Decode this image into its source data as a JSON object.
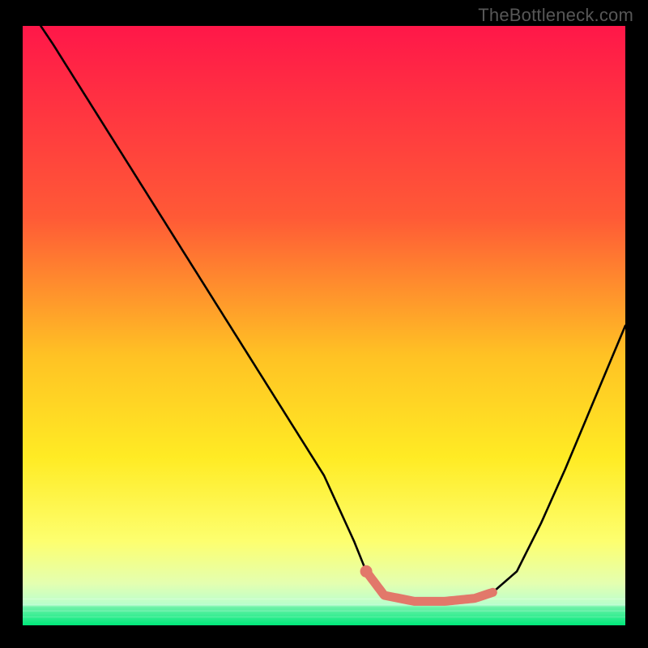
{
  "watermark": "TheBottleneck.com",
  "colors": {
    "gradient_top": "#ff1749",
    "gradient_mid1": "#ff7f2a",
    "gradient_mid2": "#ffeb24",
    "gradient_mid3": "#fdff6f",
    "gradient_mid4": "#e4ffb0",
    "gradient_bottom": "#00e87a",
    "curve": "#000000",
    "highlight": "#e2786a",
    "highlight_dot": "#e2786a"
  },
  "chart_data": {
    "type": "line",
    "title": "",
    "xlabel": "",
    "ylabel": "",
    "xlim": [
      0,
      100
    ],
    "ylim": [
      0,
      100
    ],
    "series": [
      {
        "name": "bottleneck_curve",
        "x": [
          3,
          5,
          10,
          15,
          20,
          25,
          30,
          35,
          40,
          45,
          50,
          55,
          57,
          60,
          65,
          70,
          75,
          78,
          82,
          86,
          90,
          95,
          100
        ],
        "y": [
          100,
          97,
          89,
          81,
          73,
          65,
          57,
          49,
          41,
          33,
          25,
          14,
          9,
          5,
          4,
          4,
          4.5,
          5.5,
          9,
          17,
          26,
          38,
          50
        ]
      }
    ],
    "highlight": {
      "x": [
        57,
        60,
        65,
        70,
        75,
        78
      ],
      "y": [
        9,
        5,
        4,
        4,
        4.5,
        5.5
      ]
    },
    "dot": {
      "x": 57,
      "y": 9
    }
  }
}
